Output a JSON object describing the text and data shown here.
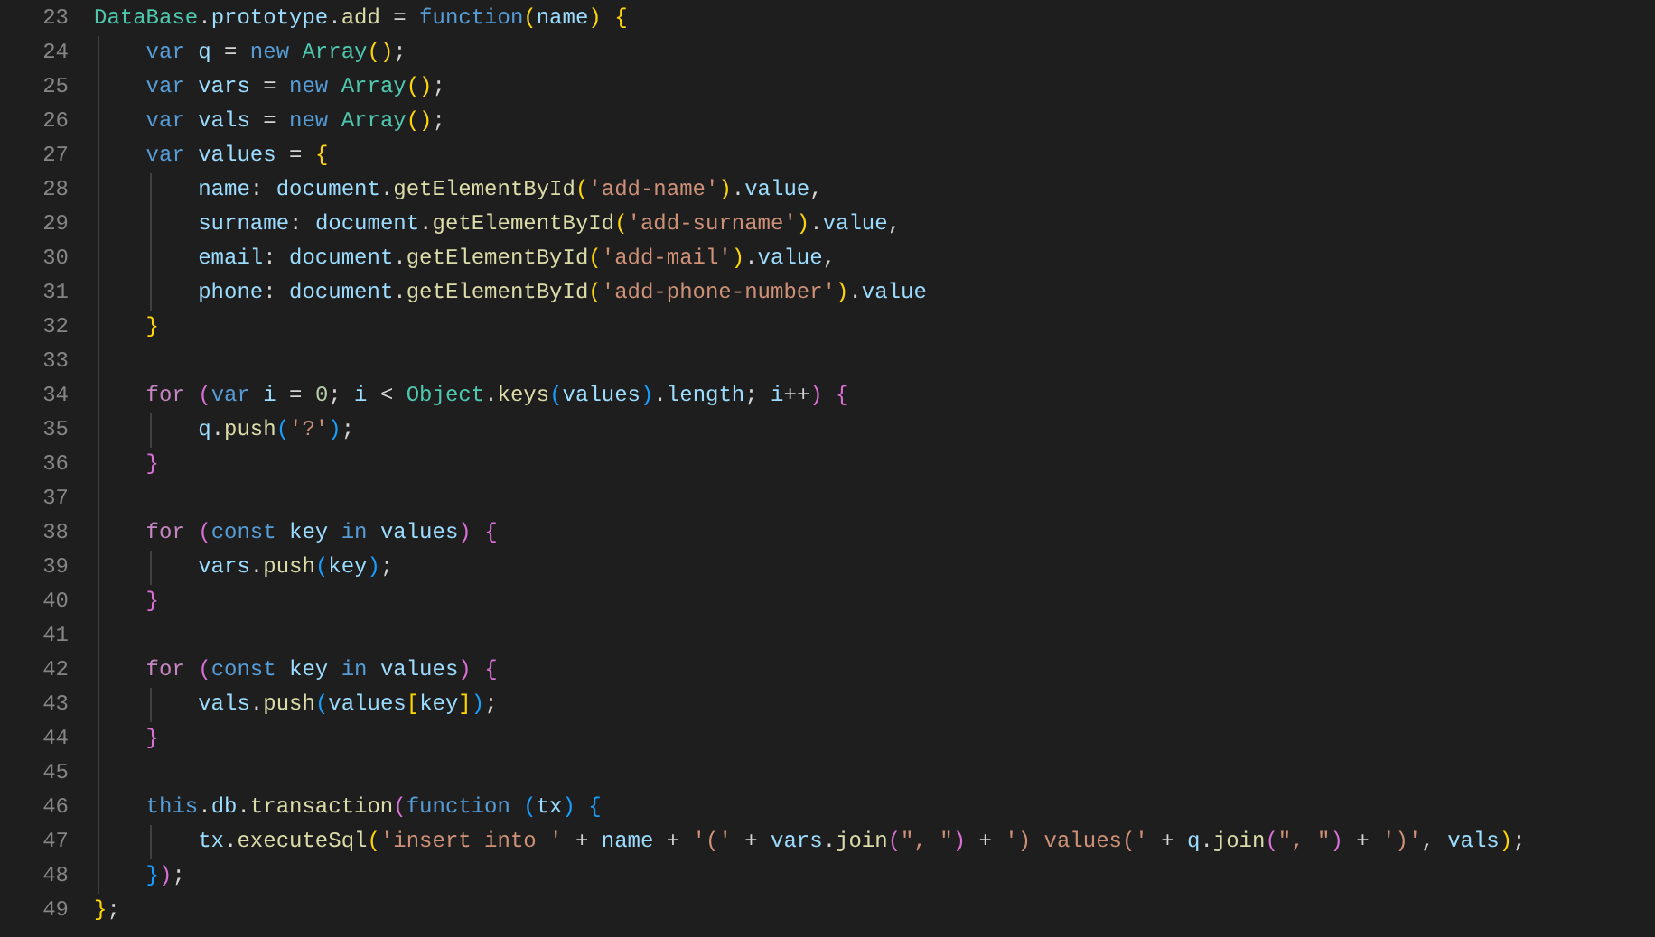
{
  "editor": {
    "lines": [
      {
        "number": "23",
        "tokens": [
          {
            "text": "DataBase",
            "kind": "cls"
          },
          {
            "text": ".",
            "kind": "op"
          },
          {
            "text": "prototype",
            "kind": "var"
          },
          {
            "text": ".",
            "kind": "op"
          },
          {
            "text": "add",
            "kind": "fn"
          },
          {
            "text": " = ",
            "kind": "op"
          },
          {
            "text": "function",
            "kind": "kw"
          },
          {
            "text": "(",
            "kind": "b1"
          },
          {
            "text": "name",
            "kind": "var"
          },
          {
            "text": ") {",
            "kind": "b1"
          }
        ]
      },
      {
        "number": "24",
        "tokens": [
          {
            "text": "    var ",
            "kind": "kw"
          },
          {
            "text": "q",
            "kind": "var"
          },
          {
            "text": " = ",
            "kind": "op"
          },
          {
            "text": "new ",
            "kind": "kw"
          },
          {
            "text": "Array",
            "kind": "cls"
          },
          {
            "text": "()",
            "kind": "b1"
          },
          {
            "text": ";",
            "kind": "op"
          }
        ]
      },
      {
        "number": "25",
        "tokens": [
          {
            "text": "    var ",
            "kind": "kw"
          },
          {
            "text": "vars",
            "kind": "var"
          },
          {
            "text": " = ",
            "kind": "op"
          },
          {
            "text": "new ",
            "kind": "kw"
          },
          {
            "text": "Array",
            "kind": "cls"
          },
          {
            "text": "()",
            "kind": "b1"
          },
          {
            "text": ";",
            "kind": "op"
          }
        ]
      },
      {
        "number": "26",
        "tokens": [
          {
            "text": "    var ",
            "kind": "kw"
          },
          {
            "text": "vals",
            "kind": "var"
          },
          {
            "text": " = ",
            "kind": "op"
          },
          {
            "text": "new ",
            "kind": "kw"
          },
          {
            "text": "Array",
            "kind": "cls"
          },
          {
            "text": "()",
            "kind": "b1"
          },
          {
            "text": ";",
            "kind": "op"
          }
        ]
      },
      {
        "number": "27",
        "tokens": [
          {
            "text": "    var ",
            "kind": "kw"
          },
          {
            "text": "values",
            "kind": "var"
          },
          {
            "text": " = ",
            "kind": "op"
          },
          {
            "text": "{",
            "kind": "b1"
          }
        ]
      },
      {
        "number": "28",
        "tokens": [
          {
            "text": "        name",
            "kind": "var"
          },
          {
            "text": ": ",
            "kind": "op"
          },
          {
            "text": "document",
            "kind": "var"
          },
          {
            "text": ".",
            "kind": "op"
          },
          {
            "text": "getElementById",
            "kind": "fn"
          },
          {
            "text": "(",
            "kind": "b1"
          },
          {
            "text": "'add-name'",
            "kind": "str"
          },
          {
            "text": ")",
            "kind": "b1"
          },
          {
            "text": ".",
            "kind": "op"
          },
          {
            "text": "value",
            "kind": "var"
          },
          {
            "text": ",",
            "kind": "op"
          }
        ]
      },
      {
        "number": "29",
        "tokens": [
          {
            "text": "        surname",
            "kind": "var"
          },
          {
            "text": ": ",
            "kind": "op"
          },
          {
            "text": "document",
            "kind": "var"
          },
          {
            "text": ".",
            "kind": "op"
          },
          {
            "text": "getElementById",
            "kind": "fn"
          },
          {
            "text": "(",
            "kind": "b1"
          },
          {
            "text": "'add-surname'",
            "kind": "str"
          },
          {
            "text": ")",
            "kind": "b1"
          },
          {
            "text": ".",
            "kind": "op"
          },
          {
            "text": "value",
            "kind": "var"
          },
          {
            "text": ",",
            "kind": "op"
          }
        ]
      },
      {
        "number": "30",
        "tokens": [
          {
            "text": "        email",
            "kind": "var"
          },
          {
            "text": ": ",
            "kind": "op"
          },
          {
            "text": "document",
            "kind": "var"
          },
          {
            "text": ".",
            "kind": "op"
          },
          {
            "text": "getElementById",
            "kind": "fn"
          },
          {
            "text": "(",
            "kind": "b1"
          },
          {
            "text": "'add-mail'",
            "kind": "str"
          },
          {
            "text": ")",
            "kind": "b1"
          },
          {
            "text": ".",
            "kind": "op"
          },
          {
            "text": "value",
            "kind": "var"
          },
          {
            "text": ",",
            "kind": "op"
          }
        ]
      },
      {
        "number": "31",
        "tokens": [
          {
            "text": "        phone",
            "kind": "var"
          },
          {
            "text": ": ",
            "kind": "op"
          },
          {
            "text": "document",
            "kind": "var"
          },
          {
            "text": ".",
            "kind": "op"
          },
          {
            "text": "getElementById",
            "kind": "fn"
          },
          {
            "text": "(",
            "kind": "b1"
          },
          {
            "text": "'add-phone-number'",
            "kind": "str"
          },
          {
            "text": ")",
            "kind": "b1"
          },
          {
            "text": ".",
            "kind": "op"
          },
          {
            "text": "value",
            "kind": "var"
          }
        ]
      },
      {
        "number": "32",
        "tokens": [
          {
            "text": "    }",
            "kind": "b1"
          }
        ]
      },
      {
        "number": "33"
      },
      {
        "number": "34",
        "tokens": [
          {
            "text": "    for ",
            "kind": "ctl"
          },
          {
            "text": "(",
            "kind": "b2"
          },
          {
            "text": "var ",
            "kind": "kw"
          },
          {
            "text": "i",
            "kind": "var"
          },
          {
            "text": " = ",
            "kind": "op"
          },
          {
            "text": "0",
            "kind": "num"
          },
          {
            "text": "; ",
            "kind": "op"
          },
          {
            "text": "i",
            "kind": "var"
          },
          {
            "text": " < ",
            "kind": "op"
          },
          {
            "text": "Object",
            "kind": "cls"
          },
          {
            "text": ".",
            "kind": "op"
          },
          {
            "text": "keys",
            "kind": "fn"
          },
          {
            "text": "(",
            "kind": "b3"
          },
          {
            "text": "values",
            "kind": "var"
          },
          {
            "text": ")",
            "kind": "b3"
          },
          {
            "text": ".",
            "kind": "op"
          },
          {
            "text": "length",
            "kind": "var"
          },
          {
            "text": "; ",
            "kind": "op"
          },
          {
            "text": "i",
            "kind": "var"
          },
          {
            "text": "++",
            "kind": "op"
          },
          {
            "text": ") {",
            "kind": "b2"
          }
        ]
      },
      {
        "number": "35",
        "tokens": [
          {
            "text": "        q",
            "kind": "var"
          },
          {
            "text": ".",
            "kind": "op"
          },
          {
            "text": "push",
            "kind": "fn"
          },
          {
            "text": "(",
            "kind": "b3"
          },
          {
            "text": "'?'",
            "kind": "str"
          },
          {
            "text": ")",
            "kind": "b3"
          },
          {
            "text": ";",
            "kind": "op"
          }
        ]
      },
      {
        "number": "36",
        "tokens": [
          {
            "text": "    }",
            "kind": "b2"
          }
        ]
      },
      {
        "number": "37"
      },
      {
        "number": "38",
        "tokens": [
          {
            "text": "    for ",
            "kind": "ctl"
          },
          {
            "text": "(",
            "kind": "b2"
          },
          {
            "text": "const ",
            "kind": "kw"
          },
          {
            "text": "key ",
            "kind": "var"
          },
          {
            "text": "in ",
            "kind": "kw"
          },
          {
            "text": "values",
            "kind": "var"
          },
          {
            "text": ") {",
            "kind": "b2"
          }
        ]
      },
      {
        "number": "39",
        "tokens": [
          {
            "text": "        vars",
            "kind": "var"
          },
          {
            "text": ".",
            "kind": "op"
          },
          {
            "text": "push",
            "kind": "fn"
          },
          {
            "text": "(",
            "kind": "b3"
          },
          {
            "text": "key",
            "kind": "var"
          },
          {
            "text": ")",
            "kind": "b3"
          },
          {
            "text": ";",
            "kind": "op"
          }
        ]
      },
      {
        "number": "40",
        "tokens": [
          {
            "text": "    }",
            "kind": "b2"
          }
        ]
      },
      {
        "number": "41"
      },
      {
        "number": "42",
        "tokens": [
          {
            "text": "    for ",
            "kind": "ctl"
          },
          {
            "text": "(",
            "kind": "b2"
          },
          {
            "text": "const ",
            "kind": "kw"
          },
          {
            "text": "key ",
            "kind": "var"
          },
          {
            "text": "in ",
            "kind": "kw"
          },
          {
            "text": "values",
            "kind": "var"
          },
          {
            "text": ") {",
            "kind": "b2"
          }
        ]
      },
      {
        "number": "43",
        "tokens": [
          {
            "text": "        vals",
            "kind": "var"
          },
          {
            "text": ".",
            "kind": "op"
          },
          {
            "text": "push",
            "kind": "fn"
          },
          {
            "text": "(",
            "kind": "b3"
          },
          {
            "text": "values",
            "kind": "var"
          },
          {
            "text": "[",
            "kind": "b1"
          },
          {
            "text": "key",
            "kind": "var"
          },
          {
            "text": "]",
            "kind": "b1"
          },
          {
            "text": ")",
            "kind": "b3"
          },
          {
            "text": ";",
            "kind": "op"
          }
        ]
      },
      {
        "number": "44",
        "tokens": [
          {
            "text": "    }",
            "kind": "b2"
          }
        ]
      },
      {
        "number": "45"
      },
      {
        "number": "46",
        "tokens": [
          {
            "text": "    this",
            "kind": "kw"
          },
          {
            "text": ".",
            "kind": "op"
          },
          {
            "text": "db",
            "kind": "var"
          },
          {
            "text": ".",
            "kind": "op"
          },
          {
            "text": "transaction",
            "kind": "fn"
          },
          {
            "text": "(",
            "kind": "b2"
          },
          {
            "text": "function ",
            "kind": "kw"
          },
          {
            "text": "(",
            "kind": "b3"
          },
          {
            "text": "tx",
            "kind": "var"
          },
          {
            "text": ") {",
            "kind": "b3"
          }
        ]
      },
      {
        "number": "47",
        "tokens": [
          {
            "text": "        tx",
            "kind": "var"
          },
          {
            "text": ".",
            "kind": "op"
          },
          {
            "text": "executeSql",
            "kind": "fn"
          },
          {
            "text": "(",
            "kind": "b1"
          },
          {
            "text": "'insert into '",
            "kind": "str"
          },
          {
            "text": " + ",
            "kind": "op"
          },
          {
            "text": "name",
            "kind": "var"
          },
          {
            "text": " + ",
            "kind": "op"
          },
          {
            "text": "'('",
            "kind": "str"
          },
          {
            "text": " + ",
            "kind": "op"
          },
          {
            "text": "vars",
            "kind": "var"
          },
          {
            "text": ".",
            "kind": "op"
          },
          {
            "text": "join",
            "kind": "fn"
          },
          {
            "text": "(",
            "kind": "b2"
          },
          {
            "text": "\", \"",
            "kind": "str"
          },
          {
            "text": ")",
            "kind": "b2"
          },
          {
            "text": " + ",
            "kind": "op"
          },
          {
            "text": "') values('",
            "kind": "str"
          },
          {
            "text": " + ",
            "kind": "op"
          },
          {
            "text": "q",
            "kind": "var"
          },
          {
            "text": ".",
            "kind": "op"
          },
          {
            "text": "join",
            "kind": "fn"
          },
          {
            "text": "(",
            "kind": "b2"
          },
          {
            "text": "\", \"",
            "kind": "str"
          },
          {
            "text": ")",
            "kind": "b2"
          },
          {
            "text": " + ",
            "kind": "op"
          },
          {
            "text": "')'",
            "kind": "str"
          },
          {
            "text": ", ",
            "kind": "op"
          },
          {
            "text": "vals",
            "kind": "var"
          },
          {
            "text": ")",
            "kind": "b1"
          },
          {
            "text": ";",
            "kind": "op"
          }
        ]
      },
      {
        "number": "48",
        "tokens": [
          {
            "text": "    }",
            "kind": "b3"
          },
          {
            "text": ")",
            "kind": "b2"
          },
          {
            "text": ";",
            "kind": "op"
          }
        ]
      },
      {
        "number": "49",
        "tokens": [
          {
            "text": "}",
            "kind": "b1"
          },
          {
            "text": ";",
            "kind": "op"
          }
        ]
      }
    ]
  }
}
